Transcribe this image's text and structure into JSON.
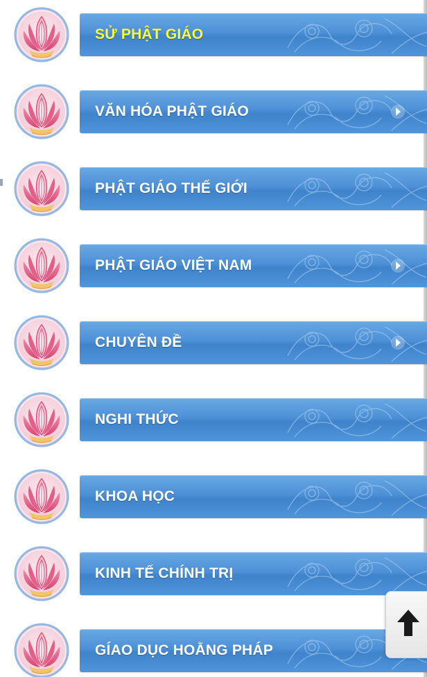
{
  "menu": {
    "items": [
      {
        "label": "SỬ PHẬT GIÁO",
        "active": true,
        "has_arrow": false
      },
      {
        "label": "VĂN HÓA PHẬT GIÁO",
        "active": false,
        "has_arrow": true
      },
      {
        "label": "PHẬT GIÁO THẾ GIỚI",
        "active": false,
        "has_arrow": false
      },
      {
        "label": "PHẬT GIÁO VIỆT NAM",
        "active": false,
        "has_arrow": true
      },
      {
        "label": "CHUYÊN ĐỀ",
        "active": false,
        "has_arrow": true
      },
      {
        "label": "NGHI THỨC",
        "active": false,
        "has_arrow": false
      },
      {
        "label": "KHOA HỌC",
        "active": false,
        "has_arrow": false
      },
      {
        "label": "KINH TẾ CHÍNH TRỊ",
        "active": false,
        "has_arrow": false
      },
      {
        "label": "GÍAO DỤC HOẰNG PHÁP",
        "active": false,
        "has_arrow": true
      }
    ]
  },
  "icons": {
    "item_icon": "lotus-icon",
    "expand_icon": "chevron-right-icon",
    "scroll_top_icon": "arrow-up-icon"
  },
  "colors": {
    "bar_blue": "#4d90d6",
    "active_label": "#ffff33",
    "label": "#ffffff",
    "lotus_pink": "#e15a86",
    "lotus_ring": "#8fb9e4"
  }
}
